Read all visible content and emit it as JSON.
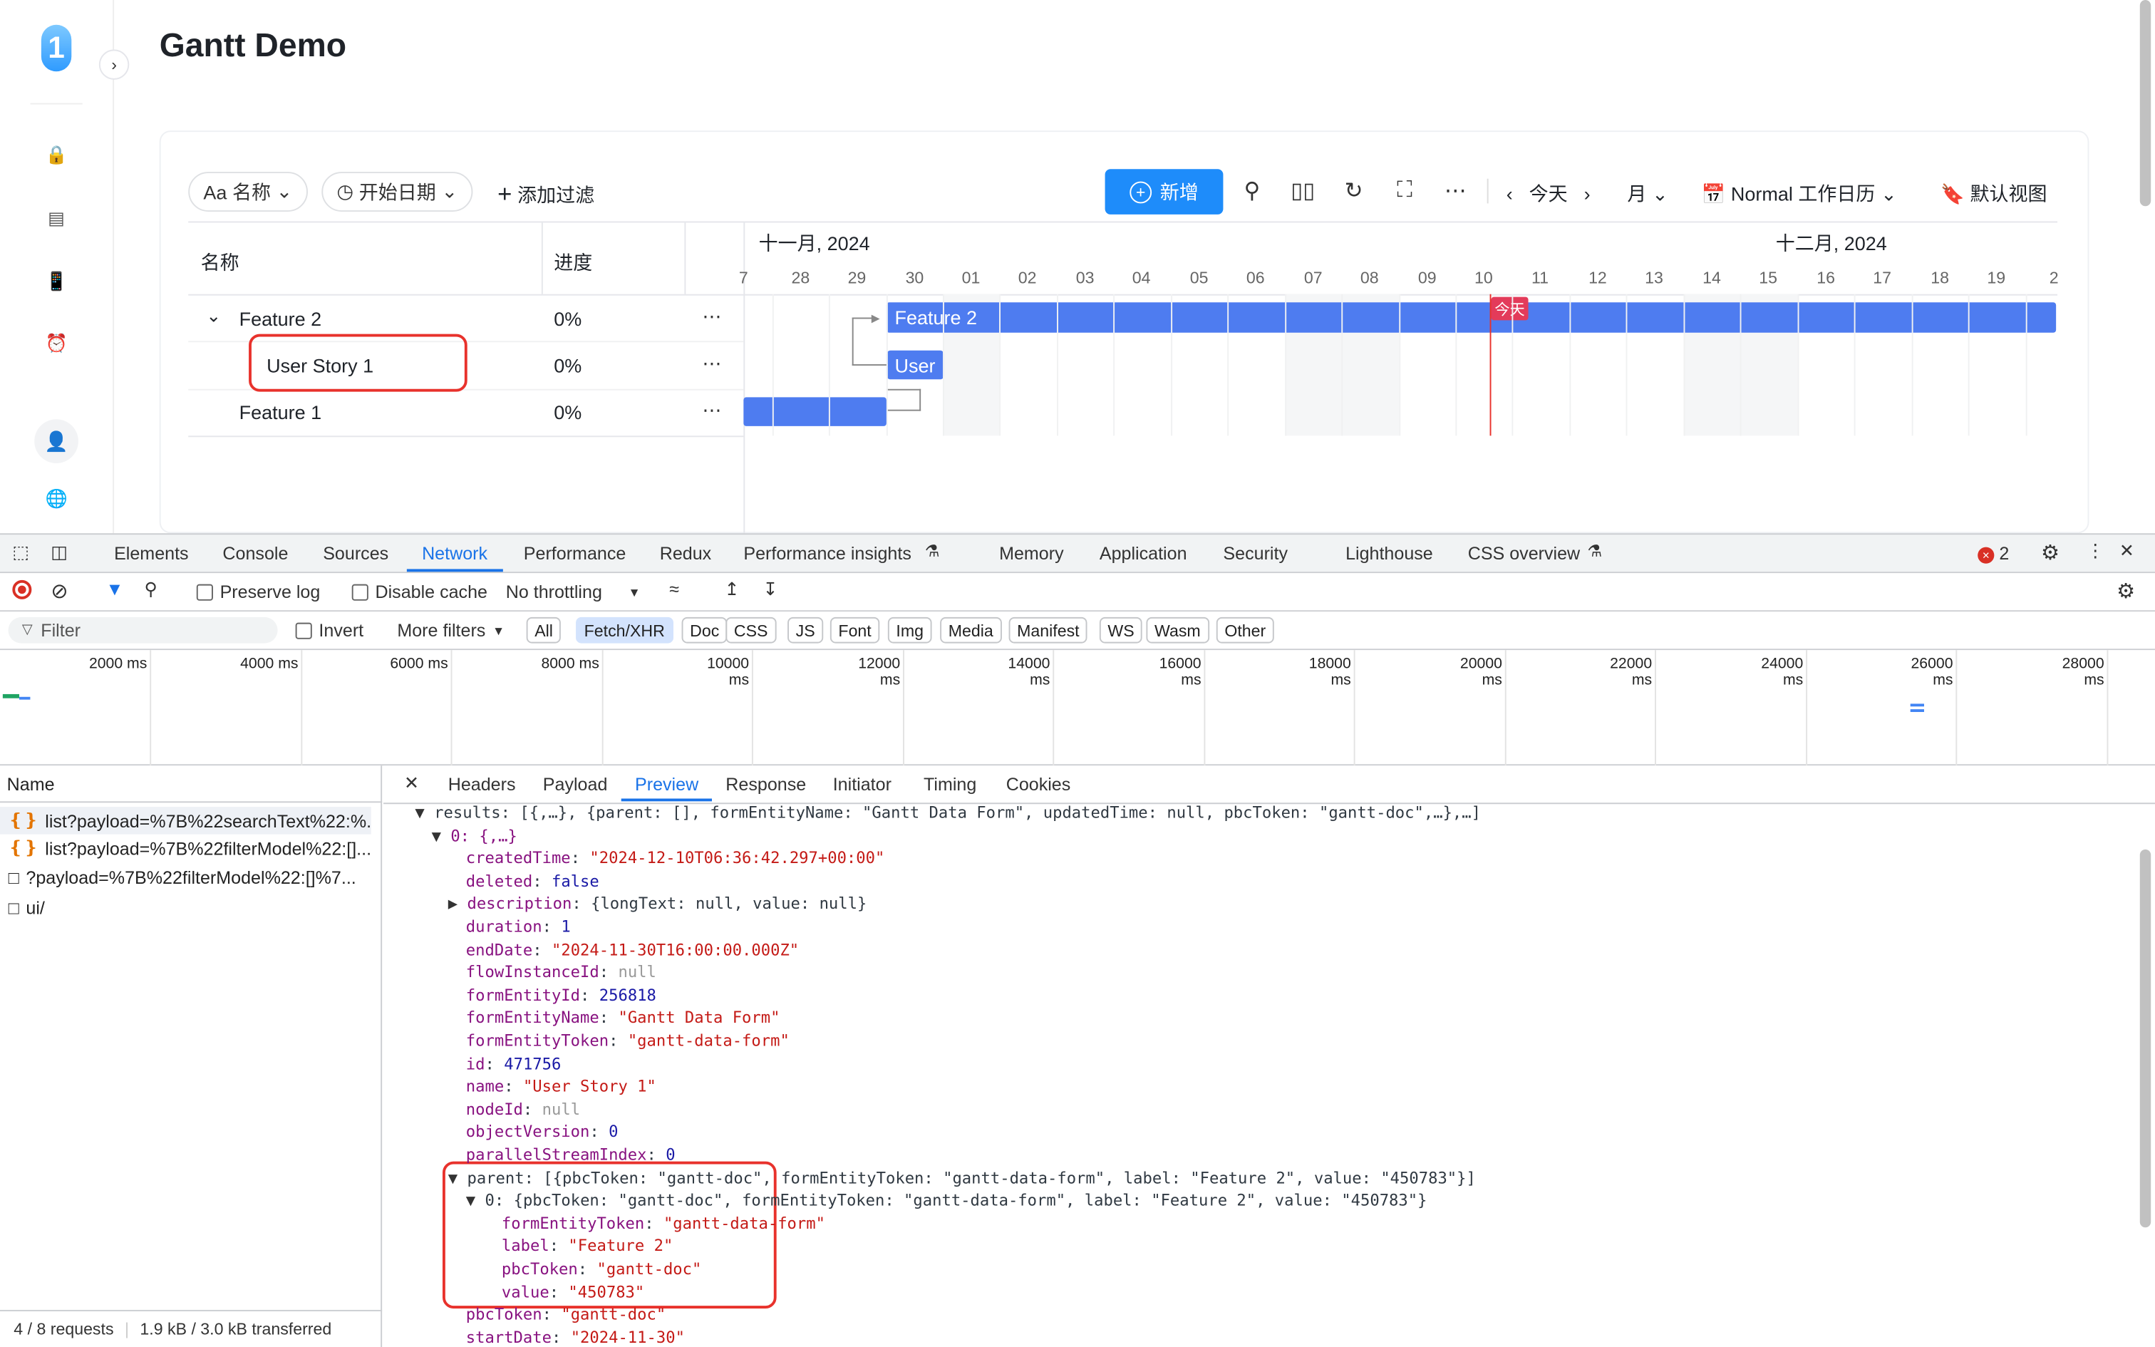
{
  "app": {
    "title": "Gantt Demo",
    "logo_text": "1",
    "sidebar_icons": [
      "lock-icon",
      "list-icon",
      "doc-icon",
      "alarm-icon"
    ],
    "user_icon": "user-icon",
    "globe_icon": "globe-icon"
  },
  "toolbar": {
    "name_chip": "Aa 名称",
    "start_chip": "开始日期",
    "add_filter": "添加过滤",
    "add_button": "新增",
    "today": "今天",
    "month": "月",
    "calendar": "Normal 工作日历",
    "default_view": "默认视图"
  },
  "table": {
    "col_name": "名称",
    "col_progress": "进度",
    "rows": [
      {
        "name": "Feature 2",
        "progress": "0%"
      },
      {
        "name": "User Story 1",
        "progress": "0%"
      },
      {
        "name": "Feature 1",
        "progress": "0%"
      }
    ]
  },
  "timeline": {
    "month1": "十一月, 2024",
    "month2": "十二月, 2024",
    "days": [
      "7",
      "28",
      "29",
      "30",
      "01",
      "02",
      "03",
      "04",
      "05",
      "06",
      "07",
      "08",
      "09",
      "10",
      "11",
      "12",
      "13",
      "14",
      "15",
      "16",
      "17",
      "18",
      "19",
      "2"
    ],
    "today_tag": "今天",
    "bar_feature2": "Feature 2",
    "bar_user": "User"
  },
  "devtools": {
    "tabs": [
      "Elements",
      "Console",
      "Sources",
      "Network",
      "Performance",
      "Redux",
      "Performance insights",
      "Memory",
      "Application",
      "Security",
      "Lighthouse",
      "CSS overview"
    ],
    "error_count": "2",
    "preserve_log": "Preserve log",
    "disable_cache": "Disable cache",
    "throttling": "No throttling",
    "filter_placeholder": "Filter",
    "invert": "Invert",
    "more_filters": "More filters",
    "filter_chips": [
      "All",
      "Fetch/XHR",
      "Doc",
      "CSS",
      "JS",
      "Font",
      "Img",
      "Media",
      "Manifest",
      "WS",
      "Wasm",
      "Other"
    ],
    "timeline_labels": [
      "2000 ms",
      "4000 ms",
      "6000 ms",
      "8000 ms",
      "10000 ms",
      "12000 ms",
      "14000 ms",
      "16000 ms",
      "18000 ms",
      "20000 ms",
      "22000 ms",
      "24000 ms",
      "26000 ms",
      "28000 ms"
    ],
    "name_header": "Name",
    "requests": [
      "list?payload=%7B%22searchText%22:%...",
      "list?payload=%7B%22filterModel%22:[]...",
      "?payload=%7B%22filterModel%22:[]%7...",
      "ui/"
    ],
    "footer_requests": "4 / 8 requests",
    "footer_transferred": "1.9 kB / 3.0 kB transferred",
    "detail_tabs": [
      "Headers",
      "Payload",
      "Preview",
      "Response",
      "Initiator",
      "Timing",
      "Cookies"
    ]
  },
  "preview": {
    "results_line": "results: [{,…}, {parent: [], formEntityName: \"Gantt Data Form\", updatedTime: null, pbcToken: \"gantt-doc\",…},…]",
    "item0": "0: {,…}",
    "fields": [
      {
        "key": "createdTime",
        "val": "\"2024-12-10T06:36:42.297+00:00\"",
        "t": "s"
      },
      {
        "key": "deleted",
        "val": "false",
        "t": "n"
      },
      {
        "key": "description",
        "val": "{longText: null, value: null}",
        "t": "o"
      },
      {
        "key": "duration",
        "val": "1",
        "t": "n"
      },
      {
        "key": "endDate",
        "val": "\"2024-11-30T16:00:00.000Z\"",
        "t": "s"
      },
      {
        "key": "flowInstanceId",
        "val": "null",
        "t": "nul"
      },
      {
        "key": "formEntityId",
        "val": "256818",
        "t": "n"
      },
      {
        "key": "formEntityName",
        "val": "\"Gantt Data Form\"",
        "t": "s"
      },
      {
        "key": "formEntityToken",
        "val": "\"gantt-data-form\"",
        "t": "s"
      },
      {
        "key": "id",
        "val": "471756",
        "t": "n"
      },
      {
        "key": "name",
        "val": "\"User Story 1\"",
        "t": "s"
      },
      {
        "key": "nodeId",
        "val": "null",
        "t": "nul"
      },
      {
        "key": "objectVersion",
        "val": "0",
        "t": "n"
      },
      {
        "key": "parallelStreamIndex",
        "val": "0",
        "t": "n"
      }
    ],
    "parent_line": "parent: [{pbcToken: \"gantt-doc\", formEntityToken: \"gantt-data-form\", label: \"Feature 2\", value: \"450783\"}]",
    "parent0_line": "0: {pbcToken: \"gantt-doc\", formEntityToken: \"gantt-data-form\", label: \"Feature 2\", value: \"450783\"}",
    "parent_fields": [
      {
        "key": "formEntityToken",
        "val": "\"gantt-data-form\""
      },
      {
        "key": "label",
        "val": "\"Feature 2\""
      },
      {
        "key": "pbcToken",
        "val": "\"gantt-doc\""
      },
      {
        "key": "value",
        "val": "\"450783\""
      }
    ],
    "tail_fields": [
      {
        "key": "pbcToken",
        "val": "\"gantt-doc\""
      },
      {
        "key": "startDate",
        "val": "\"2024-11-30\""
      }
    ]
  }
}
